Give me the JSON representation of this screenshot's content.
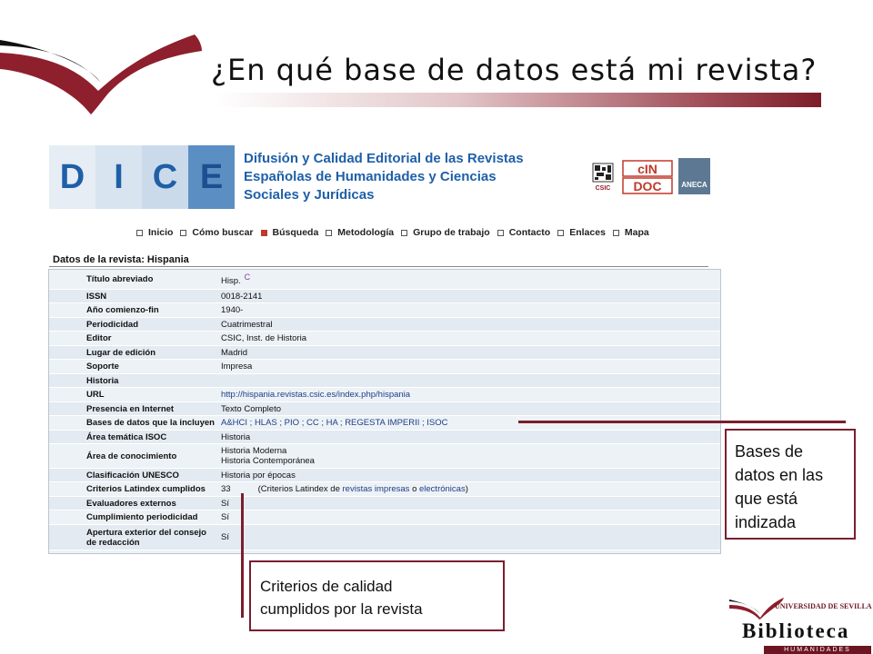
{
  "slide": {
    "title": "¿En qué base de datos está mi revista?"
  },
  "dice": {
    "letters": [
      "D",
      "I",
      "C",
      "E"
    ],
    "heading_lines": [
      "Difusión y Calidad Editorial de las Revistas",
      "Españolas de Humanidades y Ciencias",
      "Sociales y Jurídicas"
    ],
    "partner_logos": {
      "csic": "CSIC",
      "cindoc_top": "cIN",
      "cindoc_bottom": "DOC",
      "aneca": "ANECA"
    }
  },
  "nav": {
    "items": [
      "Inicio",
      "Cómo buscar",
      "Búsqueda",
      "Metodología",
      "Grupo de trabajo",
      "Contacto",
      "Enlaces",
      "Mapa"
    ],
    "active": "Búsqueda"
  },
  "record": {
    "heading": "Datos de la revista: Hispania",
    "rows": [
      {
        "label": "Título abreviado",
        "value": "Hisp.",
        "sup": "C"
      },
      {
        "label": "ISSN",
        "value": "0018-2141"
      },
      {
        "label": "Año comienzo-fin",
        "value": "1940-"
      },
      {
        "label": "Periodicidad",
        "value": "Cuatrimestral"
      },
      {
        "label": "Editor",
        "value": "CSIC, Inst. de Historia"
      },
      {
        "label": "Lugar de edición",
        "value": "Madrid"
      },
      {
        "label": "Soporte",
        "value": "Impresa"
      },
      {
        "label": "Historia",
        "value": ""
      },
      {
        "label": "URL",
        "value": "http://hispania.revistas.csic.es/index.php/hispania",
        "link": true
      },
      {
        "label": "Presencia en Internet",
        "value": "Texto Completo"
      },
      {
        "label": "Bases de datos que la incluyen",
        "value": "A&HCI ; HLAS ; PIO ; CC ; HA ; REGESTA IMPERII ; ISOC",
        "link": true
      },
      {
        "label": "Área temática ISOC",
        "value": "Historia"
      },
      {
        "label": "Área de conocimiento",
        "value": "Historia Moderna",
        "value2": "Historia Contemporánea"
      },
      {
        "label": "Clasificación UNESCO",
        "value": "Historia por épocas"
      },
      {
        "label": "Criterios Latindex cumplidos",
        "value": "33",
        "note_pre": "(Criterios Latindex de ",
        "note_link1": "revistas impresas",
        "note_mid": " o ",
        "note_link2": "electrónicas",
        "note_post": ")"
      },
      {
        "label": "Evaluadores externos",
        "value": "Sí"
      },
      {
        "label": "Cumplimiento periodicidad",
        "value": "Sí"
      },
      {
        "label": "Apertura exterior del consejo",
        "label2": "de redacción",
        "value": "Sí"
      }
    ]
  },
  "callouts": {
    "databases": [
      "Bases de",
      "datos en las",
      "que está",
      "indizada"
    ],
    "criteria": [
      "Criterios de calidad",
      "cumplidos por la revista"
    ]
  },
  "library": {
    "university": "UNIVERSIDAD DE SEVILLA",
    "name": "Biblioteca",
    "section": "HUMANIDADES"
  },
  "colors": {
    "accent": "#7a1e2e",
    "dice_blue": "#1f5fa8",
    "link": "#203d87"
  }
}
